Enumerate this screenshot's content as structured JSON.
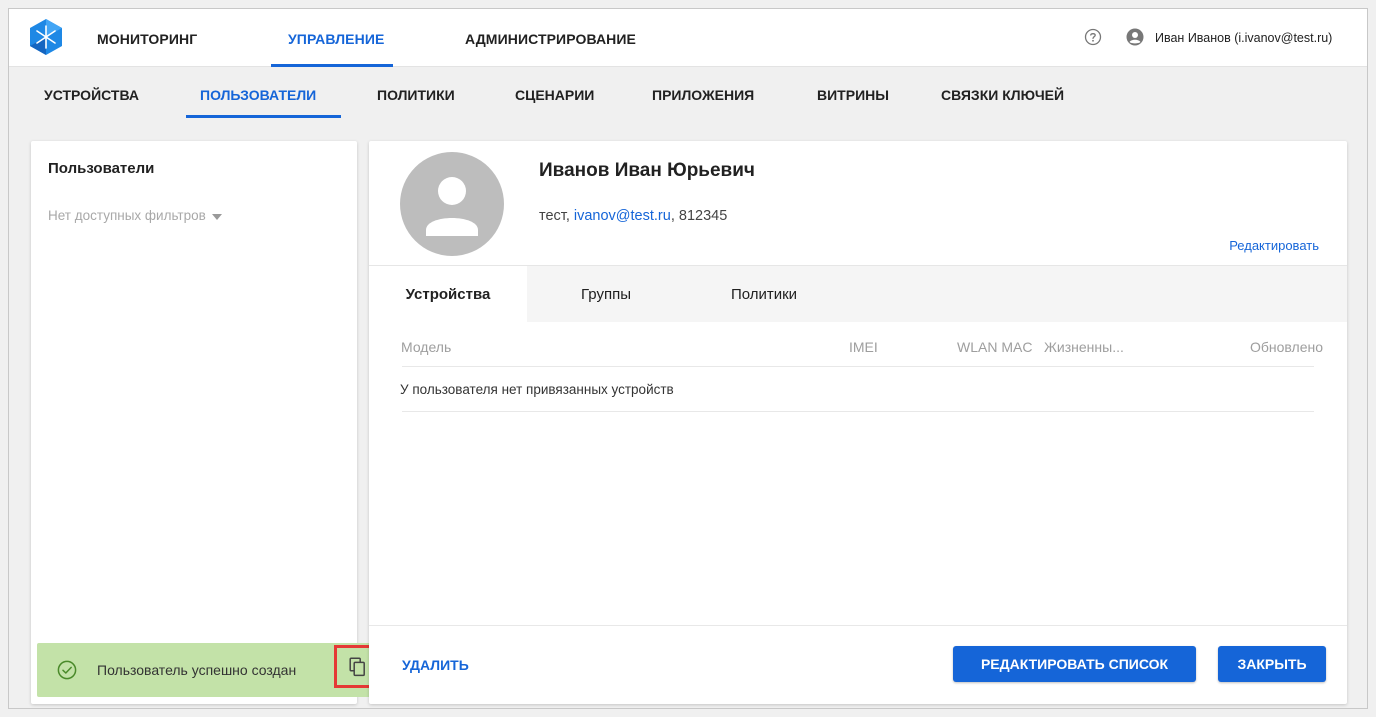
{
  "topbar": {
    "nav": [
      "МОНИТОРИНГ",
      "УПРАВЛЕНИЕ",
      "АДМИНИСТРИРОВАНИЕ"
    ],
    "active_nav": "УПРАВЛЕНИЕ",
    "user": "Иван Иванов (i.ivanov@test.ru)"
  },
  "subnav": {
    "items": [
      "УСТРОЙСТВА",
      "ПОЛЬЗОВАТЕЛИ",
      "ПОЛИТИКИ",
      "СЦЕНАРИИ",
      "ПРИЛОЖЕНИЯ",
      "ВИТРИНЫ",
      "СВЯЗКИ КЛЮЧЕЙ"
    ],
    "active": "ПОЛЬЗОВАТЕЛИ"
  },
  "left_panel": {
    "title": "Пользователи",
    "filter": "Нет доступных фильтров"
  },
  "toast": {
    "text": "Пользователь успешно создан"
  },
  "user_card": {
    "full_name": "Иванов Иван Юрьевич",
    "details_prefix": "тест, ",
    "email": "ivanov@test.ru",
    "details_suffix": ", 812345",
    "edit_label": "Редактировать"
  },
  "tabs": [
    "Устройства",
    "Группы",
    "Политики"
  ],
  "active_tab": "Устройства",
  "table": {
    "columns": [
      "Модель",
      "IMEI",
      "WLAN MAC",
      "Жизненны...",
      "Обновлено"
    ],
    "empty_text": "У пользователя нет привязанных устройств"
  },
  "actions": {
    "delete": "УДАЛИТЬ",
    "edit_list": "РЕДАКТИРОВАТЬ СПИСОК",
    "close": "ЗАКРЫТЬ"
  },
  "colors": {
    "accent": "#1565d8",
    "toast_bg": "#c3e2a8",
    "highlight_border": "#e53935"
  }
}
